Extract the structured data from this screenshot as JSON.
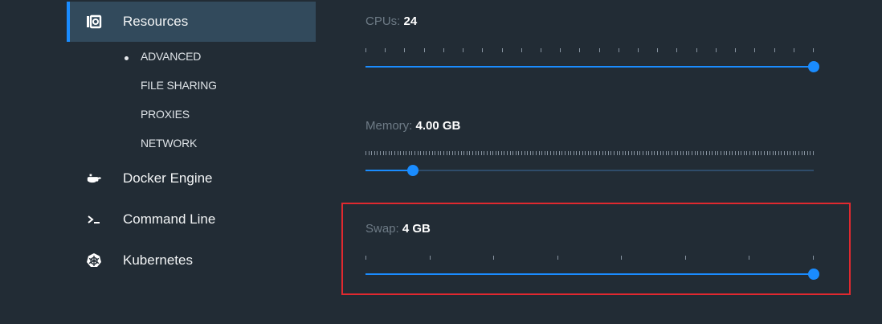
{
  "sidebar": {
    "items": [
      {
        "label": "Resources",
        "icon": "resources-icon",
        "active": true
      },
      {
        "label": "Docker Engine",
        "icon": "whale-icon",
        "active": false
      },
      {
        "label": "Command Line",
        "icon": "terminal-icon",
        "active": false
      },
      {
        "label": "Kubernetes",
        "icon": "kubernetes-icon",
        "active": false
      }
    ],
    "subitems": [
      "ADVANCED",
      "FILE SHARING",
      "PROXIES",
      "NETWORK"
    ],
    "selected_subitem": "ADVANCED"
  },
  "settings": {
    "cpus": {
      "label": "CPUs:",
      "value": "24",
      "max": 24,
      "current": 24
    },
    "memory": {
      "label": "Memory:",
      "value": "4.00 GB",
      "fraction": 0.105
    },
    "swap": {
      "label": "Swap:",
      "value": "4 GB",
      "max": 4,
      "current": 4
    }
  },
  "colors": {
    "background": "#222c35",
    "accent": "#1a8cff",
    "active_bg": "#324a5c",
    "highlight": "#e0292f"
  }
}
